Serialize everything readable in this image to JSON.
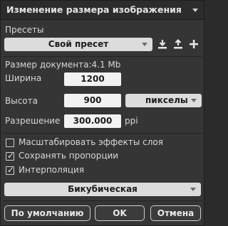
{
  "header": {
    "title": "Изменение размера изображения",
    "menu_icon": "chevron-down-icon"
  },
  "presets": {
    "label": "Пресеты",
    "selected": "Свой пресет",
    "icons": [
      "download-icon",
      "upload-icon",
      "plus-icon"
    ]
  },
  "document_size": {
    "label": "Размер документа:",
    "value": "4.1 Mb"
  },
  "width": {
    "label": "Ширина",
    "value": "1200"
  },
  "height": {
    "label": "Высота",
    "value": "900"
  },
  "units": {
    "selected": "пикселы"
  },
  "resolution": {
    "label": "Разрешение",
    "value": "300.000",
    "unit": "ppi"
  },
  "options": [
    {
      "label": "Масштабировать эффекты слоя",
      "checked": false
    },
    {
      "label": "Сохранять пропорции",
      "checked": true
    },
    {
      "label": "Интерполяция",
      "checked": true
    }
  ],
  "interpolation": {
    "selected": "Бикубическая"
  },
  "buttons": {
    "default": "По умолчанию",
    "ok": "OK",
    "cancel": "Отмена"
  },
  "colors": {
    "panel": "#353535",
    "field": "#f2f2f2",
    "dropdown": "#dcdcdc"
  }
}
